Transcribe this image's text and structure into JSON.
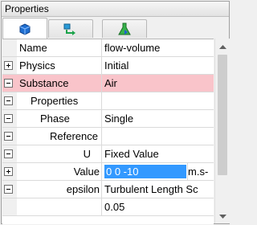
{
  "panel": {
    "title": "Properties"
  },
  "tabs": [
    {
      "icon": "cube-icon",
      "active": true
    },
    {
      "icon": "flow-arrow-icon",
      "active": false
    },
    {
      "icon": "flask-icon",
      "active": false
    }
  ],
  "rows": [
    {
      "name": "Name",
      "value": "flow-volume"
    },
    {
      "name": "Physics",
      "value": "Initial"
    },
    {
      "name": "Substance",
      "value": "Air"
    },
    {
      "name": "Properties",
      "value": ""
    },
    {
      "name": "Phase",
      "value": "Single"
    },
    {
      "name": "Reference",
      "value": ""
    },
    {
      "name": "U",
      "value": "Fixed Value"
    },
    {
      "name": "Value",
      "value": "0 0 -10",
      "unit": "m.s-"
    },
    {
      "name": "epsilon",
      "value": "Turbulent Length Sc"
    },
    {
      "name": "",
      "value": "0.05"
    }
  ],
  "colors": {
    "highlight_row": "#f9c4ca",
    "edit_selection": "#3399ff"
  }
}
